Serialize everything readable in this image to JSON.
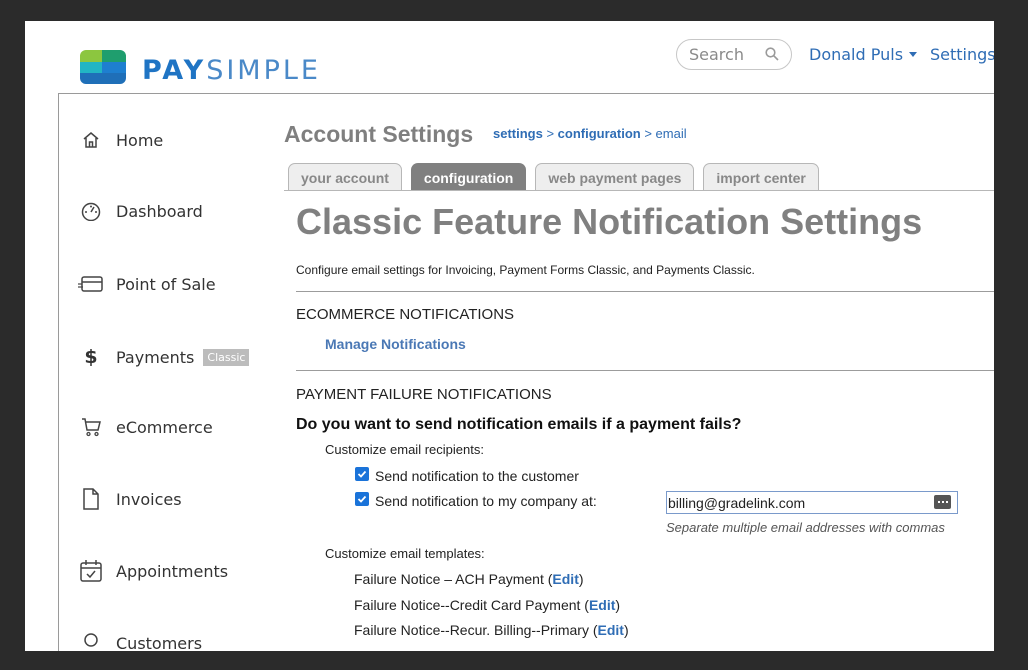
{
  "header": {
    "logo_bold": "PAY",
    "logo_light": "SIMPLE",
    "search_placeholder": "Search",
    "user_name": "Donald Puls",
    "settings_link": "Settings"
  },
  "sidebar": {
    "items": [
      {
        "label": "Home",
        "icon": "home-icon"
      },
      {
        "label": "Dashboard",
        "icon": "dashboard-icon"
      },
      {
        "label": "Point of Sale",
        "icon": "credit-card-icon"
      },
      {
        "label": "Payments",
        "icon": "dollar-icon",
        "badge": "Classic"
      },
      {
        "label": "eCommerce",
        "icon": "cart-icon"
      },
      {
        "label": "Invoices",
        "icon": "document-icon"
      },
      {
        "label": "Appointments",
        "icon": "calendar-icon"
      },
      {
        "label": "Customers",
        "icon": "user-icon"
      }
    ]
  },
  "page": {
    "title": "Account Settings",
    "breadcrumb": {
      "settings": "settings",
      "sep1": " > ",
      "configuration": "configuration",
      "sep2": " > ",
      "current": "email"
    },
    "tabs": [
      {
        "label": "your account",
        "active": false
      },
      {
        "label": "configuration",
        "active": true
      },
      {
        "label": "web payment pages",
        "active": false
      },
      {
        "label": "import center",
        "active": false
      }
    ]
  },
  "content": {
    "heading": "Classic Feature Notification Settings",
    "description": "Configure email settings for Invoicing, Payment Forms Classic, and Payments Classic.",
    "ecommerce": {
      "title": "ECOMMERCE NOTIFICATIONS",
      "manage_link": "Manage Notifications"
    },
    "failure": {
      "title": "PAYMENT FAILURE NOTIFICATIONS",
      "question": "Do you want to send notification emails if a payment fails?",
      "recipients_label": "Customize email recipients:",
      "send_customer": {
        "label": "Send notification to the customer",
        "checked": true
      },
      "send_company": {
        "label": "Send notification to my company at:",
        "checked": true
      },
      "company_email": "billing@gradelink.com",
      "email_hint": "Separate multiple email addresses with commas",
      "templates_label": "Customize email templates:",
      "templates": [
        {
          "name": "Failure Notice – ACH Payment",
          "edit": "Edit"
        },
        {
          "name": "Failure Notice--Credit Card Payment",
          "edit": "Edit"
        },
        {
          "name": "Failure Notice--Recur. Billing--Primary",
          "edit": "Edit"
        }
      ]
    }
  },
  "colors": {
    "link": "#2f6db5",
    "checkbox": "#1a73d9",
    "active_tab": "#808080"
  }
}
